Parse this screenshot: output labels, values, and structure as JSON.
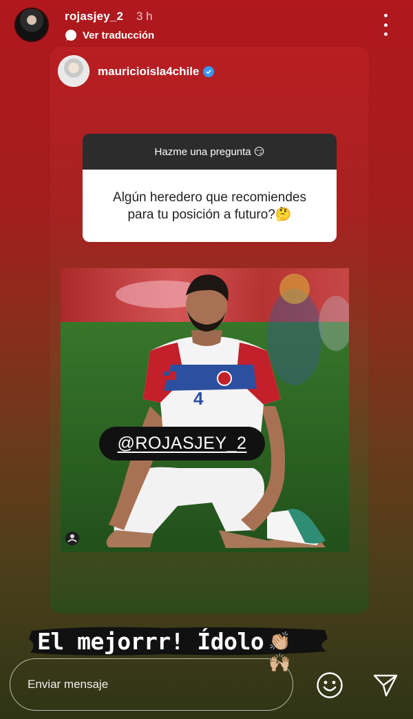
{
  "header": {
    "username": "rojasjey_2",
    "time": "3 h",
    "translate_label": "Ver traducción"
  },
  "repost": {
    "username": "mauricioisla4chile",
    "question_card": {
      "prompt": "Hazme una pregunta 😏",
      "question_line1": "Algún heredero que recomiendes",
      "question_line2": "para tu posición a futuro?🤔"
    },
    "mention": "@ROJASJEY_2"
  },
  "caption": {
    "text": "El mejorrr! Ídolo",
    "emojis": "👏🏼🙌🏼"
  },
  "reply": {
    "placeholder": "Enviar mensaje"
  },
  "icons": {
    "translate": "translate-icon",
    "more": "more-options-icon",
    "verified": "verified-badge-icon",
    "emoji": "smiley-emoji-icon",
    "send": "send-paper-plane-icon"
  },
  "colors": {
    "story_bg_top": "#b0181e",
    "story_bg_bottom": "#2e3516",
    "verified_blue": "#3897f0",
    "card_header": "#2c2c2c"
  }
}
